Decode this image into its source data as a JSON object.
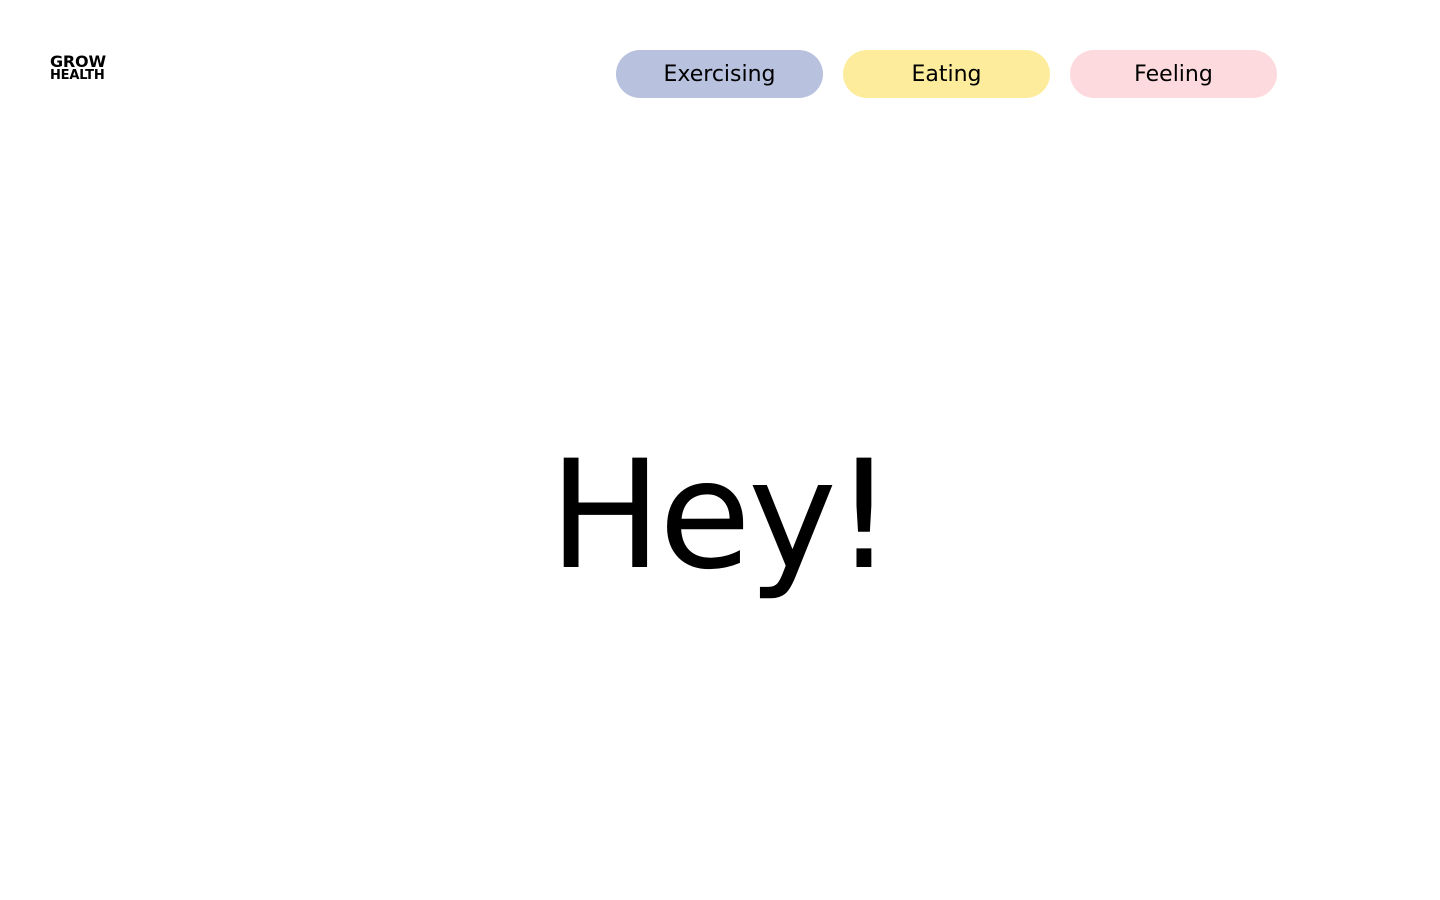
{
  "brand": {
    "line1": "GROW",
    "line2": "HEALTH"
  },
  "nav": {
    "items": [
      {
        "label": "Exercising",
        "color": "#b8c1dd"
      },
      {
        "label": "Eating",
        "color": "#fcec9c"
      },
      {
        "label": "Feeling",
        "color": "#fddadd"
      }
    ]
  },
  "hero": {
    "greeting": "Hey!"
  }
}
